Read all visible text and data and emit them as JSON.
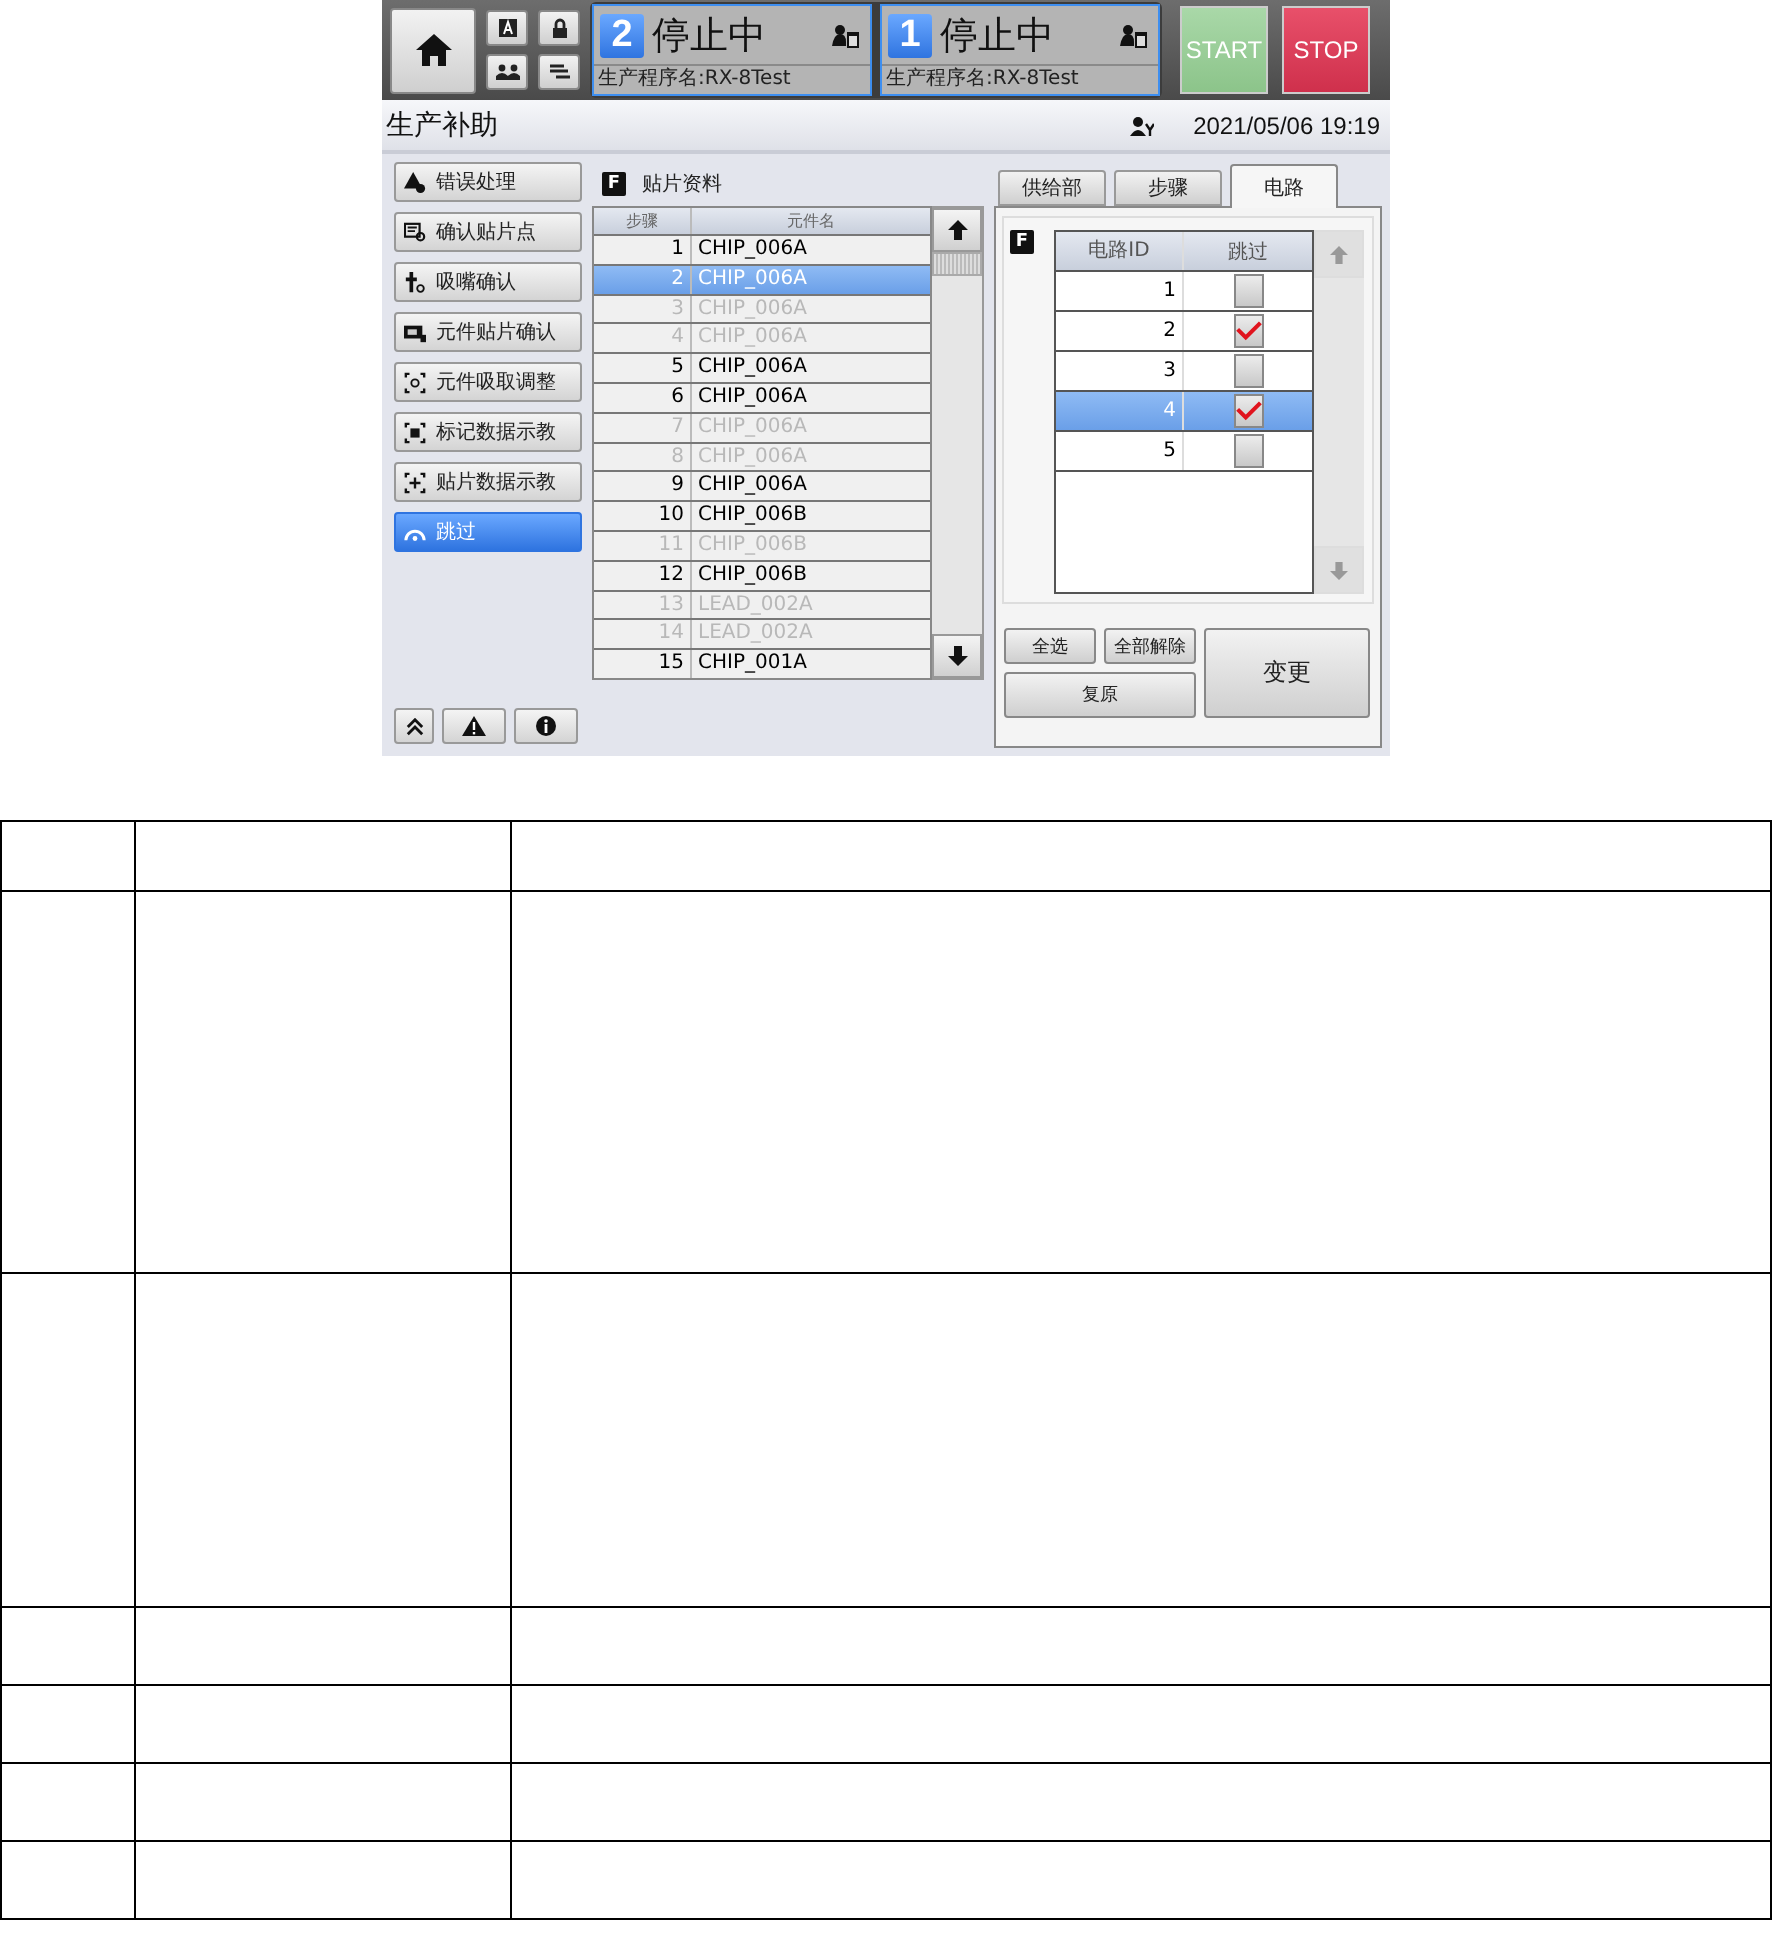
{
  "top_bar": {
    "stations": [
      {
        "number": "2",
        "status": "停止中",
        "program": "生产程序名:RX-8Test"
      },
      {
        "number": "1",
        "status": "停止中",
        "program": "生产程序名:RX-8Test"
      }
    ],
    "start_button": "START",
    "stop_button": "STOP"
  },
  "title_bar": {
    "title": "生产补助",
    "datetime": "2021/05/06 19:19"
  },
  "sidebar": {
    "items": [
      {
        "label": "错误处理",
        "selected": false
      },
      {
        "label": "确认贴片点",
        "selected": false
      },
      {
        "label": "吸嘴确认",
        "selected": false
      },
      {
        "label": "元件贴片确认",
        "selected": false
      },
      {
        "label": "元件吸取调整",
        "selected": false
      },
      {
        "label": "标记数据示教",
        "selected": false
      },
      {
        "label": "贴片数据示教",
        "selected": false
      },
      {
        "label": "跳过",
        "selected": true
      }
    ]
  },
  "placement": {
    "badge": "F",
    "title": "贴片资料",
    "columns": [
      "步骤",
      "元件名"
    ],
    "rows": [
      {
        "step": "1",
        "part": "CHIP_006A",
        "disabled": false,
        "selected": false
      },
      {
        "step": "2",
        "part": "CHIP_006A",
        "disabled": false,
        "selected": true
      },
      {
        "step": "3",
        "part": "CHIP_006A",
        "disabled": true,
        "selected": false
      },
      {
        "step": "4",
        "part": "CHIP_006A",
        "disabled": true,
        "selected": false
      },
      {
        "step": "5",
        "part": "CHIP_006A",
        "disabled": false,
        "selected": false
      },
      {
        "step": "6",
        "part": "CHIP_006A",
        "disabled": false,
        "selected": false
      },
      {
        "step": "7",
        "part": "CHIP_006A",
        "disabled": true,
        "selected": false
      },
      {
        "step": "8",
        "part": "CHIP_006A",
        "disabled": true,
        "selected": false
      },
      {
        "step": "9",
        "part": "CHIP_006A",
        "disabled": false,
        "selected": false
      },
      {
        "step": "10",
        "part": "CHIP_006B",
        "disabled": false,
        "selected": false
      },
      {
        "step": "11",
        "part": "CHIP_006B",
        "disabled": true,
        "selected": false
      },
      {
        "step": "12",
        "part": "CHIP_006B",
        "disabled": false,
        "selected": false
      },
      {
        "step": "13",
        "part": "LEAD_002A",
        "disabled": true,
        "selected": false
      },
      {
        "step": "14",
        "part": "LEAD_002A",
        "disabled": true,
        "selected": false
      },
      {
        "step": "15",
        "part": "CHIP_001A",
        "disabled": false,
        "selected": false
      }
    ]
  },
  "tabs": [
    {
      "label": "供给部",
      "selected": false
    },
    {
      "label": "步骤",
      "selected": false
    },
    {
      "label": "电路",
      "selected": true
    }
  ],
  "circuit": {
    "badge": "F",
    "columns": [
      "电路ID",
      "跳过"
    ],
    "rows": [
      {
        "id": "1",
        "checked": false,
        "selected": false
      },
      {
        "id": "2",
        "checked": true,
        "selected": false
      },
      {
        "id": "3",
        "checked": false,
        "selected": false
      },
      {
        "id": "4",
        "checked": true,
        "selected": true
      },
      {
        "id": "5",
        "checked": false,
        "selected": false
      }
    ],
    "buttons": {
      "select_all": "全选",
      "clear_all": "全部解除",
      "restore": "复原",
      "apply": "变更"
    }
  }
}
